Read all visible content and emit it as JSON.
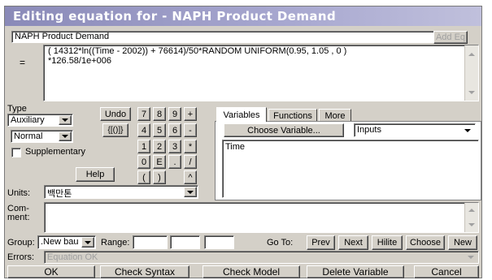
{
  "window": {
    "title": "Editing equation for - NAPH Product Demand"
  },
  "name_field": {
    "value": "NAPH Product Demand",
    "add_button": "Add Eq"
  },
  "equation": {
    "equals_label": "=",
    "line1": "( 14312*ln((Time - 2002)) + 76614)/50*RANDOM UNIFORM(0.95, 1.05 , 0 )",
    "line2": "*126.58/1e+006"
  },
  "type_panel": {
    "label": "Type",
    "type_value": "Auxiliary",
    "subtype_value": "Normal",
    "supplementary_label": "Supplementary",
    "undo_label": "Undo",
    "brackets_label": "{[()]}",
    "help_label": "Help"
  },
  "keypad": {
    "rows": [
      [
        "7",
        "8",
        "9",
        "+"
      ],
      [
        "4",
        "5",
        "6",
        "-"
      ],
      [
        "1",
        "2",
        "3",
        "*"
      ],
      [
        "0",
        "E",
        ".",
        "/"
      ],
      [
        "(",
        ")",
        "^"
      ]
    ]
  },
  "tabs": {
    "variables": "Variables",
    "functions": "Functions",
    "more": "More"
  },
  "variables_panel": {
    "choose_button": "Choose Variable...",
    "filter_value": "Inputs",
    "items": [
      "Time"
    ]
  },
  "units": {
    "label": "Units:",
    "value": "백만톤"
  },
  "comment": {
    "label_line1": "Com-",
    "label_line2": "ment:"
  },
  "group_row": {
    "group_label": "Group:",
    "group_value": ".New bau",
    "range_label": "Range:",
    "goto_label": "Go To:",
    "buttons": [
      "Prev",
      "Next",
      "Hilite",
      "Choose",
      "New"
    ]
  },
  "errors": {
    "label": "Errors:",
    "value": "Equation OK"
  },
  "footer": {
    "buttons": [
      "OK",
      "Check Syntax",
      "Check Model",
      "Delete Variable",
      "Cancel"
    ]
  }
}
